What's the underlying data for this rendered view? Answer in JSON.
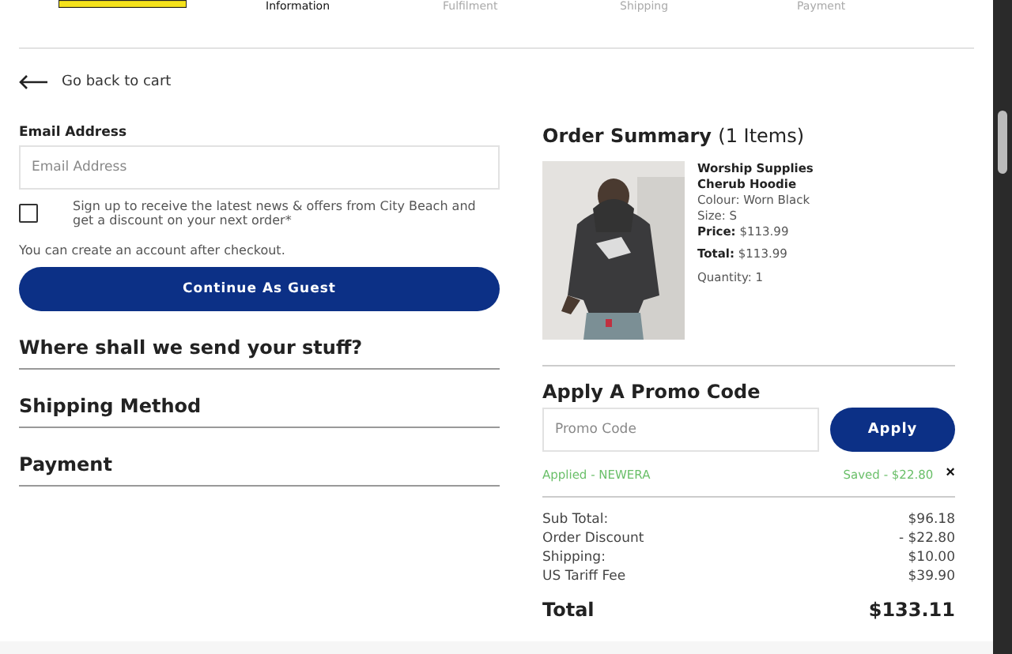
{
  "steps": [
    {
      "label": "Information",
      "selected": true
    },
    {
      "label": "Fulfilment",
      "selected": false
    },
    {
      "label": "Shipping",
      "selected": false
    },
    {
      "label": "Payment",
      "selected": false
    }
  ],
  "back_link": "Go back to cart",
  "email": {
    "label": "Email Address",
    "placeholder": "Email Address"
  },
  "newsletter": {
    "checked": false,
    "text": "Sign up to receive the latest news & offers from City Beach and get a discount on your next order*"
  },
  "account_note": "You can create an account after checkout.",
  "guest_button": "Continue As Guest",
  "sections": [
    "Where shall we send your stuff?",
    "Shipping Method",
    "Payment"
  ],
  "summary": {
    "title": "Order Summary",
    "count": "(1 Items)",
    "item": {
      "kind": "picture",
      "name": "Worship Supplies Cherub Hoodie",
      "colour": "Colour: Worn Black",
      "size": "Size: S",
      "price_label": "Price:",
      "price": "$113.99",
      "total_label": "Total:",
      "total": "$113.99",
      "quantity": "Quantity: 1"
    }
  },
  "promo": {
    "title": "Apply A Promo Code",
    "placeholder": "Promo Code",
    "button": "Apply",
    "applied": "Applied - NEWERA",
    "saved": "Saved - $22.80",
    "remove": "×"
  },
  "totals": [
    {
      "label": "Sub Total:",
      "value": "$96.18"
    },
    {
      "label": "Order Discount",
      "value": "- $22.80"
    },
    {
      "label": "Shipping:",
      "value": "$10.00"
    },
    {
      "label": "US Tariff Fee",
      "value": "$39.90"
    }
  ],
  "grand_total": {
    "label": "Total",
    "value": "$133.11"
  }
}
